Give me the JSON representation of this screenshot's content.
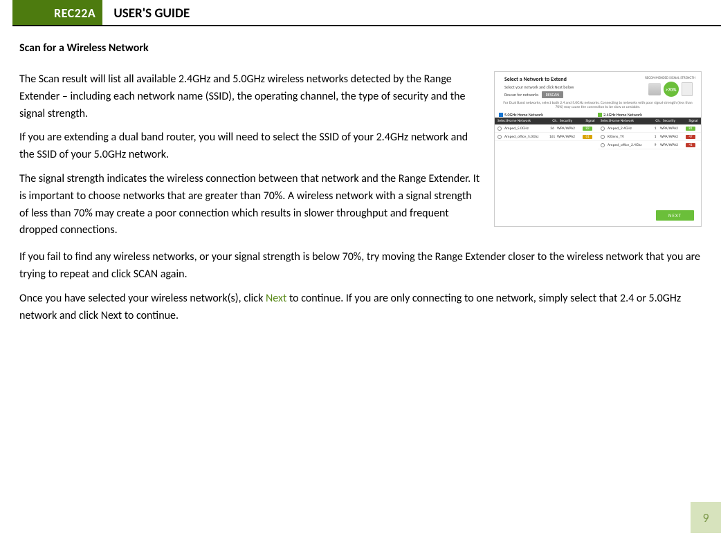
{
  "header": {
    "model": "REC22A",
    "title": "USER'S GUIDE"
  },
  "section_title": "Scan for a Wireless Network",
  "paragraphs": {
    "p1": "The Scan result will list all available 2.4GHz and 5.0GHz wireless networks detected by the Range Extender – including each network name (SSID), the operating channel, the type of security and the signal strength.",
    "p2": "If you are extending a dual band router, you will need to select the SSID of your 2.4GHz network and the SSID of your 5.0GHz network.",
    "p3": "The signal strength indicates the wireless connection between that network and the Range Extender. It is important to choose networks that are greater than 70%. A wireless network with a signal strength of less than 70% may create a poor connection which results in slower throughput and frequent dropped connections.",
    "p4": "If you fail to find any wireless networks, or your signal strength is below 70%, try moving the Range Extender closer to the wireless network that you are trying to repeat and click SCAN again.",
    "p5a": "Once you have selected your wireless network(s), click ",
    "p5link": "Next",
    "p5b": " to continue. If you are only connecting to one network, simply select that 2.4 or 5.0GHz network and click Next to continue."
  },
  "screenshot": {
    "title": "Select a Network to Extend",
    "sub1": "Select your network and click Next below",
    "sub2": "Rescan for networks",
    "rescan": "RESCAN",
    "reco": "RECOMMENDED SIGNAL STRENGTH",
    "pct": ">70%",
    "router_label": "Router",
    "ext_label": "Range Extender",
    "note": "For Dual Band networks, select both 2.4 and 5.0GHz networks. Connecting to networks with poor signal strength (less than 70%) may cause the connection to be slow or unstable.",
    "band5": "5.0GHz Home Network",
    "band24": "2.4GHz Home Network",
    "cols": {
      "select": "Select",
      "name": "Home Network",
      "ch": "Ch.",
      "sec": "Security",
      "sig": "Signal"
    },
    "rows5": [
      {
        "name": "Amped_5.0GHz",
        "ch": "36",
        "sec": "WPA/WPA2",
        "sig": "83",
        "sigc": "g"
      },
      {
        "name": "Amped_office_5.0Ghz",
        "ch": "161",
        "sec": "WPA/WPA2",
        "sig": "61",
        "sigc": "y"
      }
    ],
    "rows24": [
      {
        "name": "Amped_2.4GHz",
        "ch": "1",
        "sec": "WPA/WPA2",
        "sig": "81",
        "sigc": "g"
      },
      {
        "name": "Kittens_TV",
        "ch": "1",
        "sec": "WPA/WPA2",
        "sig": "47",
        "sigc": "r"
      },
      {
        "name": "Amped_office_2.4Ghz",
        "ch": "9",
        "sec": "WPA/WPA2",
        "sig": "41",
        "sigc": "r"
      }
    ],
    "next": "NEXT"
  },
  "page_number": "9"
}
